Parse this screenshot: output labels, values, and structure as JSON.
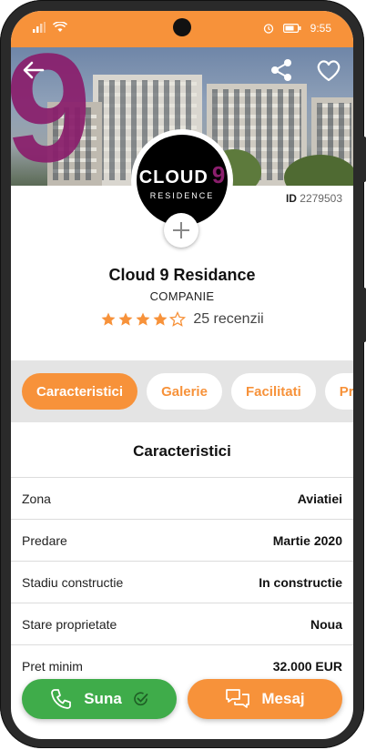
{
  "status": {
    "time": "9:55",
    "status_color": "#f7923a"
  },
  "hero": {
    "back_icon": "arrow-left-icon",
    "share_icon": "share-icon",
    "favorite_icon": "heart-icon",
    "hero_numeral": "9"
  },
  "logo": {
    "word": "CLOUD",
    "numeral": "9",
    "sub": "RESIDENCE"
  },
  "listing": {
    "id_prefix": "ID",
    "id_value": "2279503",
    "name": "Cloud 9 Residance",
    "type": "COMPANIE",
    "rating_stars": 4,
    "rating_max": 5,
    "reviews": "25 recenzii"
  },
  "tabs": [
    {
      "label": "Caracteristici",
      "active": true
    },
    {
      "label": "Galerie",
      "active": false
    },
    {
      "label": "Facilitati",
      "active": false
    },
    {
      "label": "Proprietati",
      "active": false
    }
  ],
  "section": {
    "title": "Caracteristici",
    "rows": [
      {
        "label": "Zona",
        "value": "Aviatiei"
      },
      {
        "label": "Predare",
        "value": "Martie 2020"
      },
      {
        "label": "Stadiu constructie",
        "value": "In constructie"
      },
      {
        "label": "Stare proprietate",
        "value": "Noua"
      },
      {
        "label": "Pret minim",
        "value": "32.000 EUR"
      }
    ]
  },
  "actions": {
    "call_label": "Suna",
    "message_label": "Mesaj"
  },
  "colors": {
    "accent": "#f7923a",
    "call": "#3fac4a",
    "brand_purple": "#8a1e6c"
  }
}
